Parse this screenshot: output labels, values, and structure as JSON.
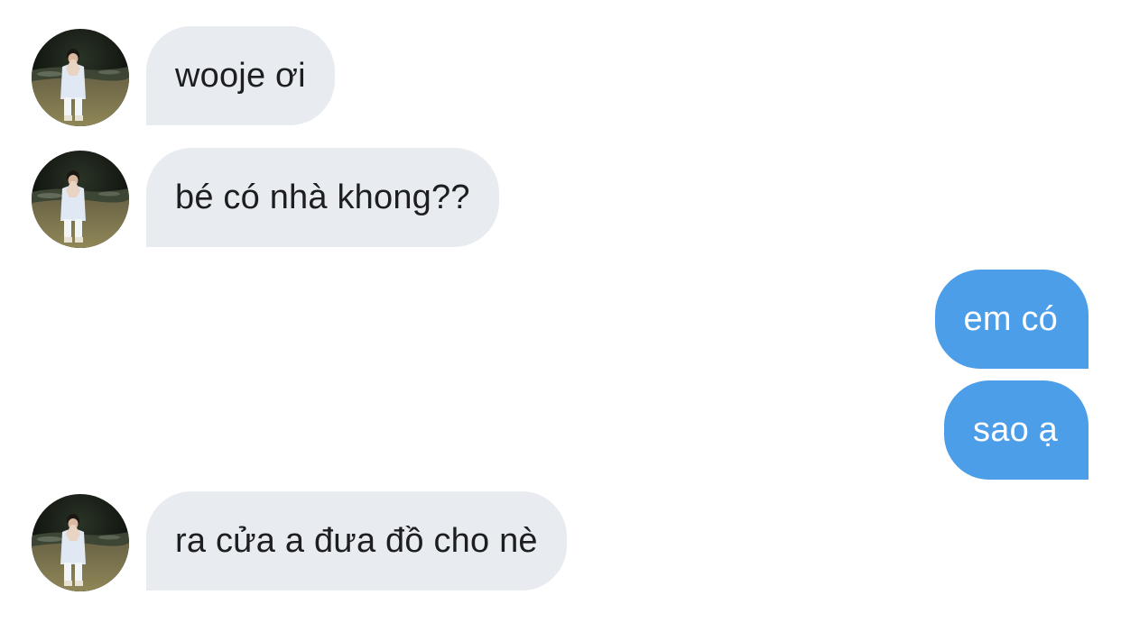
{
  "colors": {
    "incoming_bubble": "#e8ebf0",
    "incoming_text": "#1c1e21",
    "outgoing_bubble": "#4d9ee9",
    "outgoing_text": "#ffffff",
    "background": "#ffffff"
  },
  "messages": [
    {
      "direction": "incoming",
      "text": "wooje ơi",
      "avatar": "contact-avatar"
    },
    {
      "direction": "incoming",
      "text": "bé có nhà khong??",
      "avatar": "contact-avatar"
    },
    {
      "direction": "outgoing",
      "text": "em có"
    },
    {
      "direction": "outgoing",
      "text": "sao ạ"
    },
    {
      "direction": "incoming",
      "text": "ra cửa a đưa đồ cho nè",
      "avatar": "contact-avatar"
    }
  ]
}
